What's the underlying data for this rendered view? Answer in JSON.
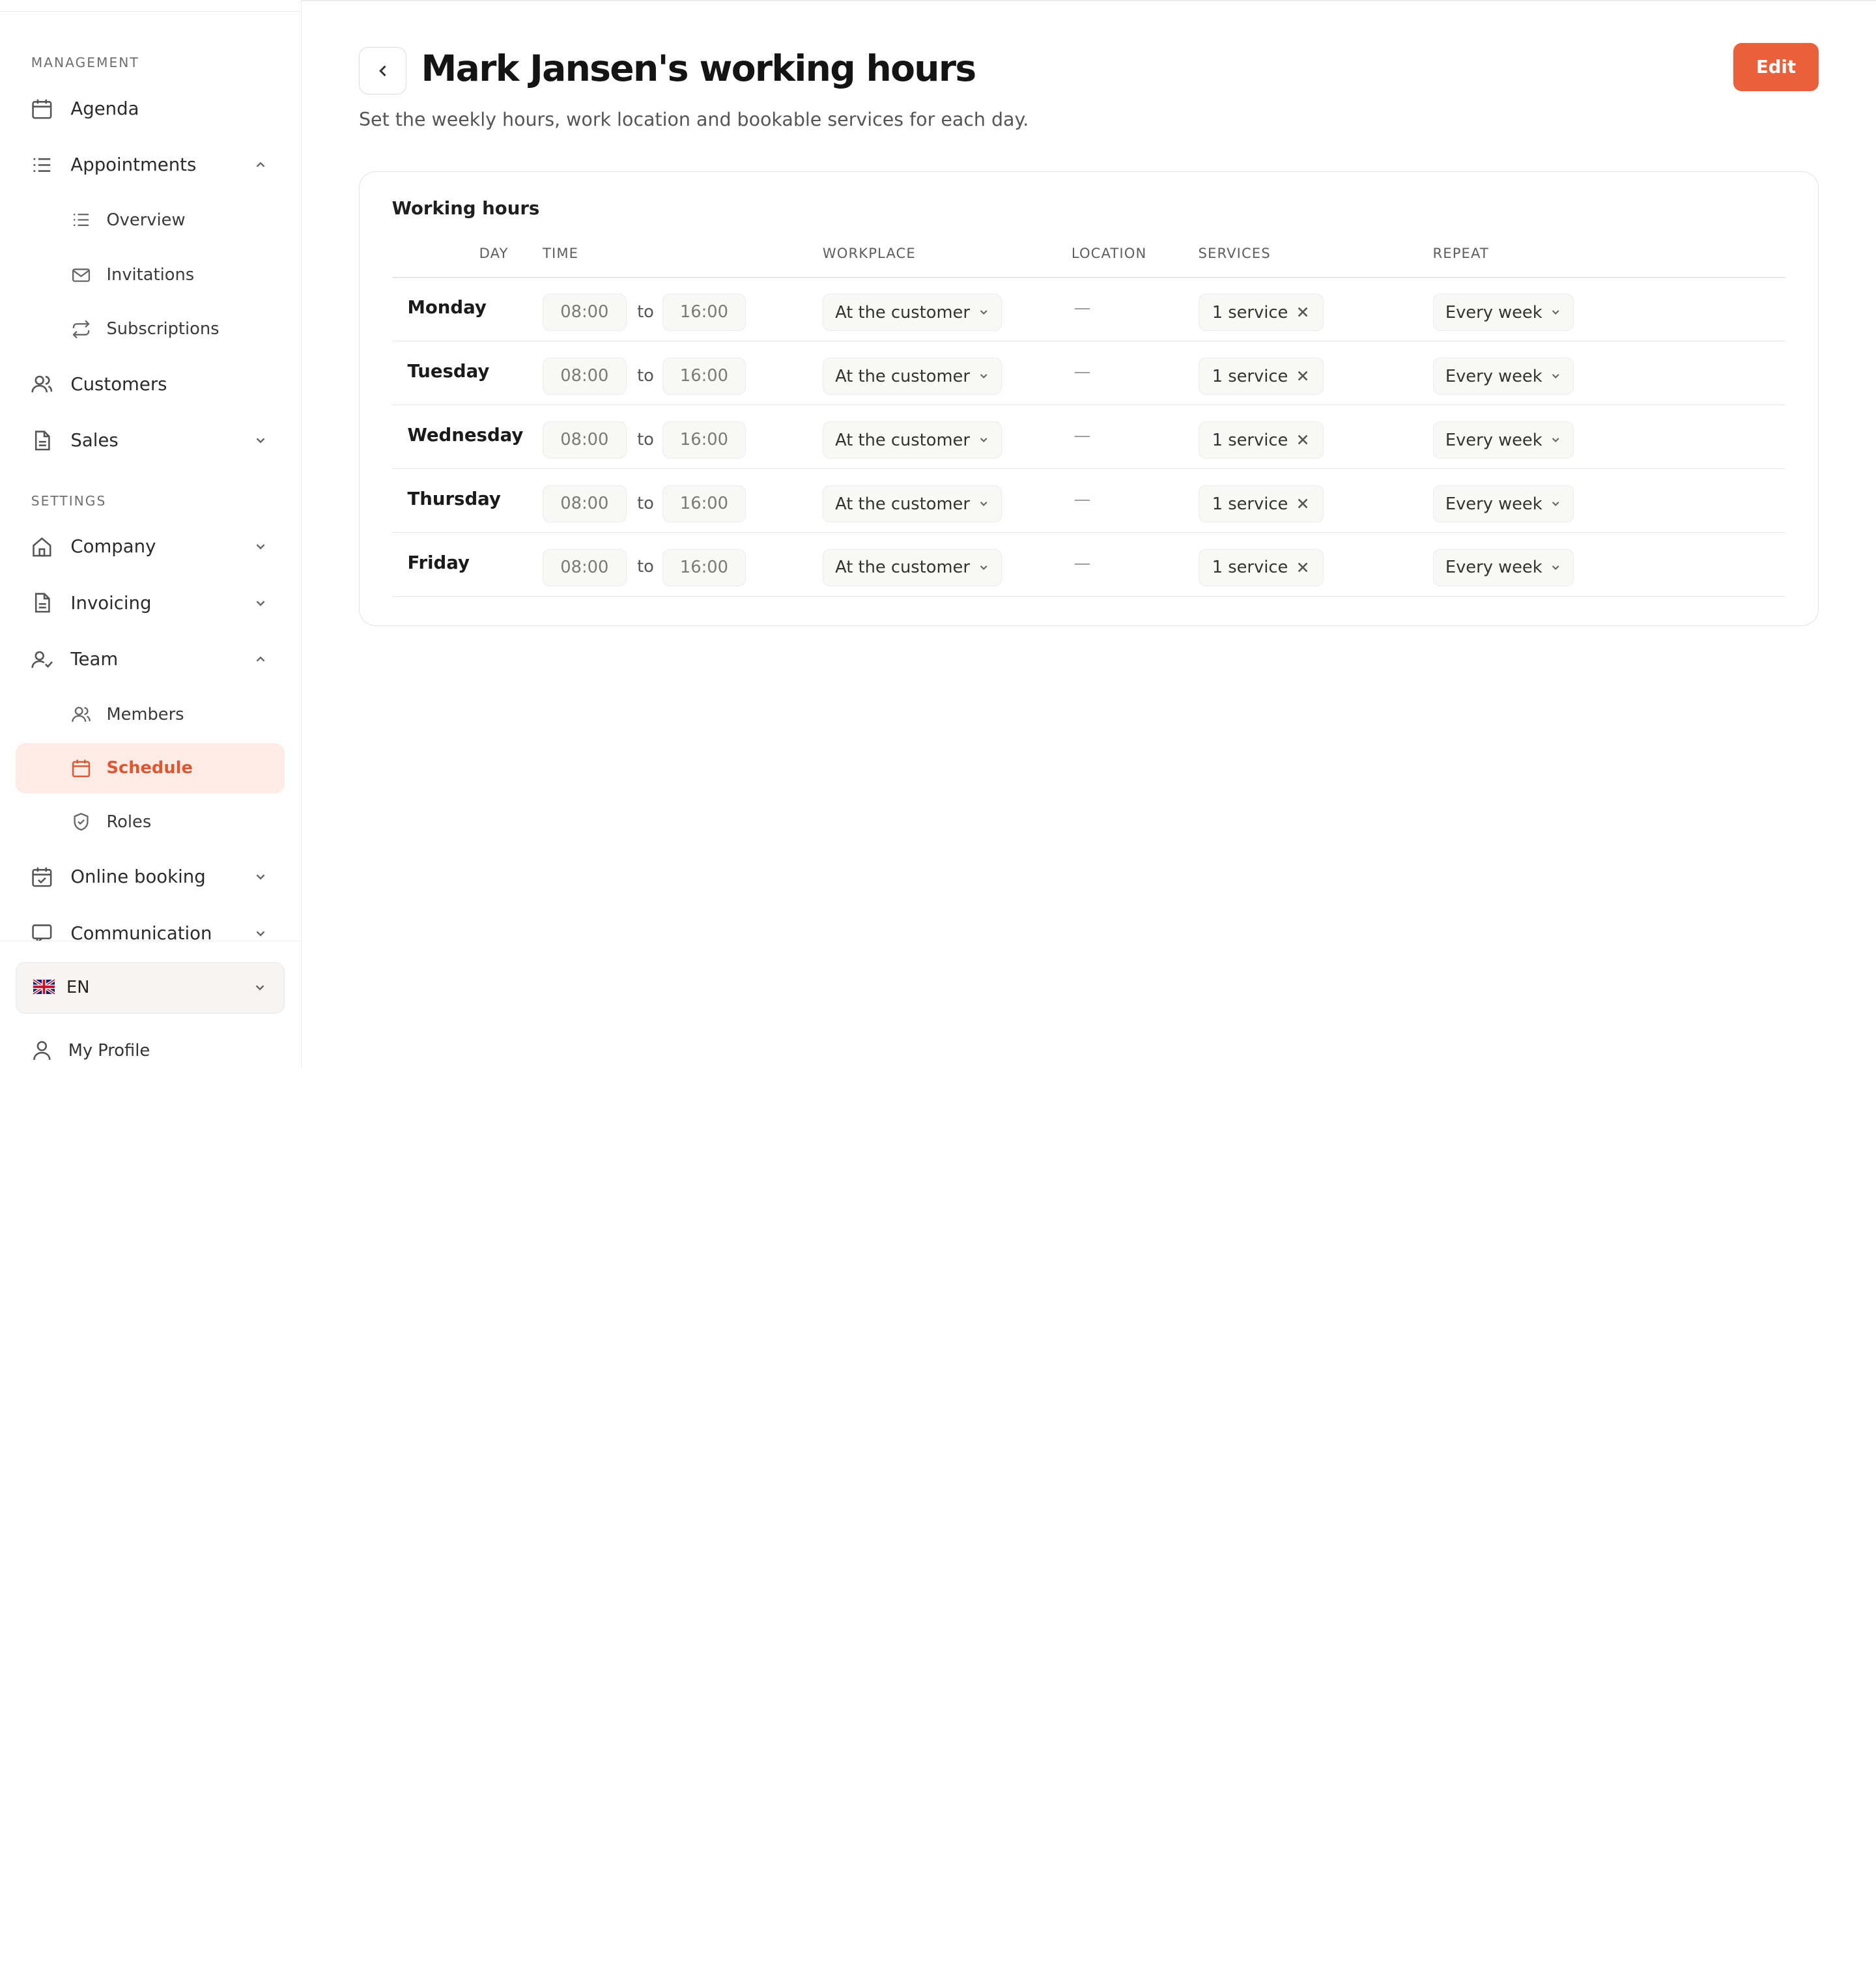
{
  "sidebar": {
    "sections": {
      "management": "MANAGEMENT",
      "settings": "SETTINGS"
    },
    "items": {
      "agenda": "Agenda",
      "appointments": "Appointments",
      "overview": "Overview",
      "invitations": "Invitations",
      "subscriptions": "Subscriptions",
      "customers": "Customers",
      "sales": "Sales",
      "company": "Company",
      "invoicing": "Invoicing",
      "team": "Team",
      "members": "Members",
      "schedule": "Schedule",
      "roles": "Roles",
      "online_booking": "Online booking",
      "communication": "Communication"
    },
    "active_item": "schedule",
    "accent_color": "#e0562f",
    "language": "EN",
    "profile": "My Profile"
  },
  "header": {
    "title": "Mark Jansen's working hours",
    "subtitle": "Set the weekly hours, work location and bookable services for each day.",
    "edit_label": "Edit",
    "edit_color": "#e9603a"
  },
  "card": {
    "title": "Working hours",
    "columns": {
      "day": "DAY",
      "time": "TIME",
      "workplace": "WORKPLACE",
      "location": "LOCATION",
      "services": "SERVICES",
      "repeat": "REPEAT"
    },
    "rows": [
      {
        "day": "Monday",
        "start": "08:00",
        "to": "to",
        "end": "16:00",
        "workplace": "At the customer",
        "location": "—",
        "services": "1 service",
        "repeat": "Every week"
      },
      {
        "day": "Tuesday",
        "start": "08:00",
        "to": "to",
        "end": "16:00",
        "workplace": "At the customer",
        "location": "—",
        "services": "1 service",
        "repeat": "Every week"
      },
      {
        "day": "Wednesday",
        "start": "08:00",
        "to": "to",
        "end": "16:00",
        "workplace": "At the customer",
        "location": "—",
        "services": "1 service",
        "repeat": "Every week"
      },
      {
        "day": "Thursday",
        "start": "08:00",
        "to": "to",
        "end": "16:00",
        "workplace": "At the customer",
        "location": "—",
        "services": "1 service",
        "repeat": "Every week"
      },
      {
        "day": "Friday",
        "start": "08:00",
        "to": "to",
        "end": "16:00",
        "workplace": "At the customer",
        "location": "—",
        "services": "1 service",
        "repeat": "Every week"
      }
    ]
  }
}
